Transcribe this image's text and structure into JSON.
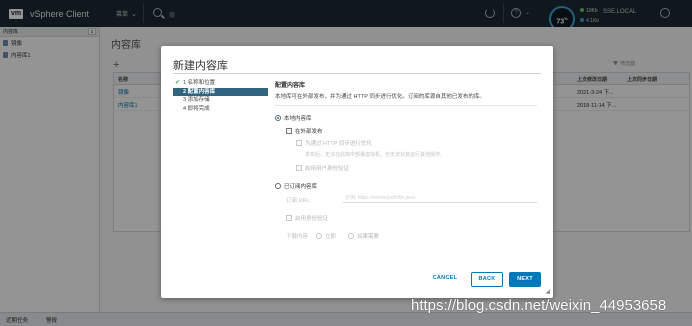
{
  "header": {
    "logo_text": "vm",
    "app_title": "vSphere Client",
    "menu_label": "菜单",
    "search_placeholder": "搜",
    "gauge_value": "73",
    "gauge_unit": "%",
    "net_up": "10Kb",
    "net_down": "4.1Kb",
    "domain": "SSE.LOCAL",
    "icons": [
      "search-icon",
      "refresh-icon",
      "help-icon",
      "chevron-down-icon",
      "user-icon"
    ]
  },
  "left_panel": {
    "title": "内容库",
    "count": "2",
    "items": [
      {
        "label": "镜像"
      },
      {
        "label": "内容库1"
      }
    ]
  },
  "main": {
    "title": "内容库",
    "add_label": "+",
    "filter_label": "筛选器",
    "columns": [
      "名称",
      "上次修改日期",
      "上次同步日期"
    ],
    "rows": [
      {
        "name": "镜像",
        "modified": "2021-3-24 下...",
        "sync": ""
      },
      {
        "name": "内容库1",
        "modified": "2018-11-14 下...",
        "sync": ""
      }
    ]
  },
  "dialog": {
    "title": "新建内容库",
    "steps": [
      {
        "label": "1 名称和位置",
        "done": true
      },
      {
        "label": "2 配置内容库",
        "active": true
      },
      {
        "label": "3 添加存储"
      },
      {
        "label": "4 即将完成"
      }
    ],
    "section_title": "配置内容库",
    "section_desc": "本地库可在外部发布，并为通过 HTTP 同步进行优化。订阅的库源自其他已发布的库。",
    "local_label": "本地内容库",
    "publish_label": "在外部发布",
    "optimize_label": "为通过 HTTP 同步进行优化",
    "optimize_desc": "发布后，无法在此库中部署虚拟机，也无法对其运行其他操作。",
    "auth_label1": "启用用户身份验证",
    "subscribed_label": "已订阅内容库",
    "sub_url_label": "订阅 URL:",
    "sub_url_placeholder": "示例: https://server/path/lib.json",
    "auth_label2": "启用身份验证",
    "download_label": "下载内容",
    "download_immediate": "立即",
    "download_when_needed": "如果需要",
    "cancel_label": "CANCEL",
    "back_label": "BACK",
    "next_label": "NEXT"
  },
  "bottombar": {
    "recent_tasks": "近期任务",
    "alarms": "警报"
  },
  "watermark": "https://blog.csdn.net/weixin_44953658",
  "colors": {
    "header_bg": "#1b2a33",
    "accent": "#0079b8",
    "active_step": "#31647f",
    "gauge_ring": "#3ea4d6"
  }
}
